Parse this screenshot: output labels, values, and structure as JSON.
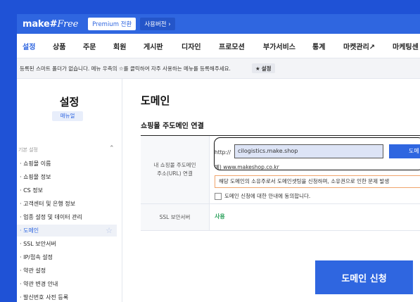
{
  "header": {
    "logo_main": "make#",
    "logo_italic": "Free",
    "premium_label": "Premium 전환",
    "version_label": "사용버전 ›"
  },
  "nav": {
    "items": [
      {
        "label": "설정",
        "active": true
      },
      {
        "label": "상품"
      },
      {
        "label": "주문"
      },
      {
        "label": "회원"
      },
      {
        "label": "게시판"
      },
      {
        "label": "디자인"
      },
      {
        "label": "프로모션"
      },
      {
        "label": "부가서비스"
      },
      {
        "label": "통계"
      },
      {
        "label": "마켓관리↗"
      },
      {
        "label": "마케팅센"
      }
    ]
  },
  "notice": {
    "text": "등록된 스마트 폴더가 없습니다. 메뉴 우측의 ☆를 클릭하여 자주 사용하는 메뉴를 등록해주세요.",
    "fav_label": "설정"
  },
  "sidebar": {
    "title": "설정",
    "manual_label": "매뉴얼",
    "section_label": "기본 설정",
    "items": [
      {
        "label": "· 쇼핑몰 이름"
      },
      {
        "label": "· 쇼핑몰 정보"
      },
      {
        "label": "· CS 정보"
      },
      {
        "label": "· 고객센터 및 은행 정보"
      },
      {
        "label": "· 업종 설정 및 데이터 관리"
      },
      {
        "label": "· 도메인",
        "active": true
      },
      {
        "label": "· SSL 보안서버"
      },
      {
        "label": "· IP/접속 설정"
      },
      {
        "label": "· 약관 설정"
      },
      {
        "label": "· 약관 변경 안내"
      },
      {
        "label": "· 발신번호 사전 등록"
      }
    ]
  },
  "main": {
    "title": "도메인",
    "section_title": "쇼핑몰 주도메인 연결",
    "row1_label_line1": "내 쇼핑몰 주도메인",
    "row1_label_line2": "주소(URL) 연결",
    "http_prefix": "http://",
    "url_value": "cilogistics.make.shop",
    "submit_label": "도메",
    "example_text": "예) www.makeshop.co.kr",
    "warning_text": "해당 도메인의 소유주로서 도메인셋팅을 신청하며, 소유권으로 인한 문제 발생",
    "agree_text": "도메인 신청에 대한 안내에 동의합니다.",
    "ssl_label": "SSL 보안서버",
    "ssl_value": "사용",
    "apply_label": "도메인 신청"
  },
  "colors": {
    "accent": "#2f66e0",
    "frame": "#1f52d6",
    "ssl_on": "#2aa05a",
    "warn_border": "#f0a46b"
  }
}
